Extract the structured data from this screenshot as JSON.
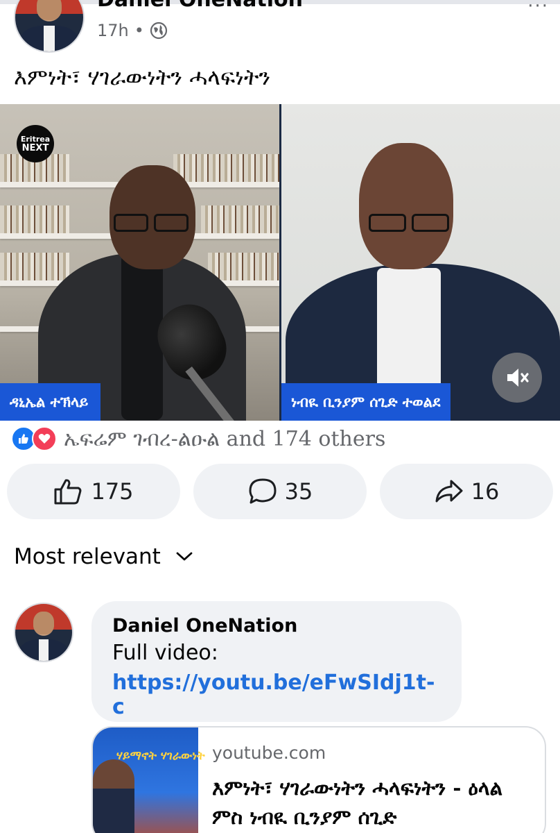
{
  "post": {
    "author": "Daniel OneNation",
    "time": "17h",
    "separator": "•",
    "privacy_icon": "globe-icon",
    "text": "እምነት፣ ሃገራውነትን ሓላፍነትን"
  },
  "video": {
    "logo_line1": "Eritrea",
    "logo_line2": "NEXT",
    "left_name": "ዳኒኤል ተኽላይ",
    "right_name": "ነብዪ ቢንያም ሰጊድ ተወልደ",
    "mute_icon": "speaker-muted-icon"
  },
  "reactions": {
    "icons": [
      "like-icon",
      "love-icon"
    ],
    "text": "ኤፍሬም ገብረ-ልዑል and 174 others"
  },
  "actions": {
    "like_count": "175",
    "comment_count": "35",
    "share_count": "16"
  },
  "comments": {
    "sort_label": "Most relevant",
    "items": [
      {
        "author": "Daniel OneNation",
        "line": "Full video:",
        "link": "https://youtu.be/eFwSIdj1t-c"
      }
    ]
  },
  "link_card": {
    "thumb_text": "ሃይማኖት ሃገራውነት",
    "domain": "youtube.com",
    "title": "እምነት፣ ሃገራውነትን ሓላፍነትን - ዕላል ምስ ነብዪ ቢንያም ሰጊድ"
  },
  "colors": {
    "link": "#216fdb",
    "name_tag": "#1a57d6",
    "like": "#1877f2",
    "love": "#f33e58"
  }
}
